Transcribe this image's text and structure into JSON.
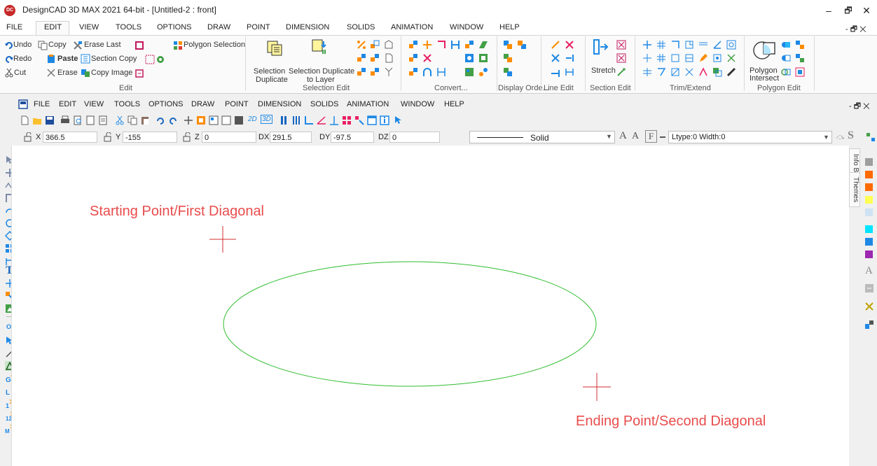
{
  "title_bar": {
    "logo_text": "DC",
    "title": "DesignCAD 3D MAX 2021 64-bit - [Untitled-2 : front]",
    "minimize": "–",
    "restore": "🗗",
    "close": "✕"
  },
  "main_menu": [
    "FILE",
    "EDIT",
    "VIEW",
    "TOOLS",
    "OPTIONS",
    "DRAW",
    "POINT",
    "DIMENSION",
    "SOLIDS",
    "ANIMATION",
    "WINDOW",
    "HELP"
  ],
  "main_menu_right": "- 🗗 ✕",
  "ribbon": {
    "edit_group": {
      "undo": "Undo",
      "copy": "Copy",
      "erase_last": "Erase Last",
      "redo": "Redo",
      "paste": "Paste",
      "section_copy": "Section Copy",
      "cut": "Cut",
      "erase": "Erase",
      "copy_image": "Copy Image",
      "polygon_selection": "Polygon Selection",
      "label": "Edit"
    },
    "selection_edit_group": {
      "selection_duplicate_1": "Selection",
      "selection_duplicate_2": "Duplicate",
      "selection_duplicate_layer_1": "Selection Duplicate",
      "selection_duplicate_layer_2": "to Layer",
      "label": "Selection Edit"
    },
    "convert_label": "Convert...",
    "display_order_label": "Display Orde...",
    "line_edit_label": "Line Edit",
    "section_edit": {
      "stretch": "Stretch",
      "label": "Section Edit"
    },
    "trim_extend_label": "Trim/Extend",
    "polygon_edit": {
      "polygon_intersect_1": "Polygon",
      "polygon_intersect_2": "Intersect",
      "label": "Polygon Edit"
    }
  },
  "inner_menu": [
    "FILE",
    "EDIT",
    "VIEW",
    "TOOLS",
    "OPTIONS",
    "DRAW",
    "POINT",
    "DIMENSION",
    "SOLIDS",
    "ANIMATION",
    "WINDOW",
    "HELP"
  ],
  "inner_menu_right": "- 🗗 ✕",
  "toolbar2": {
    "view_2d": "2D",
    "view_3d": "3D"
  },
  "coords": {
    "x_label": "X",
    "x_value": "366.5",
    "y_label": "Y",
    "y_value": "-155",
    "z_label": "Z",
    "z_value": "0",
    "dx_label": "DX",
    "dx_value": "291.5",
    "dy_label": "DY",
    "dy_value": "-97.5",
    "dz_label": "DZ",
    "dz_value": "0"
  },
  "line_style": {
    "selected": "Solid",
    "ltype_width": "Ltype:0 Width:0"
  },
  "left_toolbar": {
    "off_label": "OFF"
  },
  "right_panel": {
    "info_box_tab": "Info Box",
    "themes_tab": "Themes",
    "swatches": [
      "#9e9e9e",
      "#ff6a00",
      "#ff6a00",
      "#ffff55",
      "#cfe2f3",
      "#00e5ff",
      "#1e88e5",
      "#9c27b0"
    ]
  },
  "canvas": {
    "start_label": "Starting Point/First Diagonal",
    "end_label": "Ending Point/Second Diagonal",
    "crosshair_color": "#d32f2f",
    "ellipse_color": "#2ebd2e",
    "label_color": "#e84c4c"
  }
}
